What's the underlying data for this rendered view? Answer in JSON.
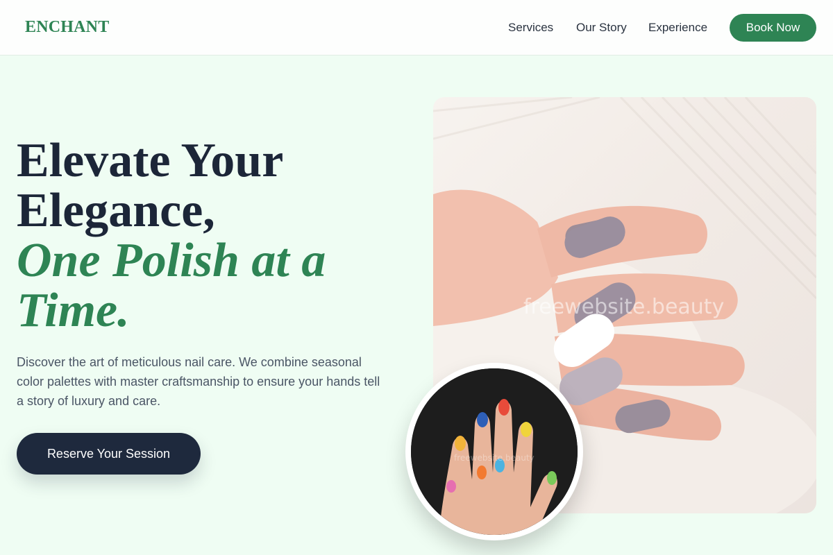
{
  "header": {
    "logo": "ENCHANT",
    "nav": [
      "Services",
      "Our Story",
      "Experience"
    ],
    "cta": "Book Now"
  },
  "hero": {
    "headline_line1": "Elevate Your",
    "headline_line2": "Elegance,",
    "headline_accent_line1": "One Polish at a",
    "headline_accent_line2": "Time.",
    "description": "Discover the art of meticulous nail care. We combine seasonal color palettes with master craftsmanship to ensure your hands tell a story of luxury and care.",
    "cta": "Reserve Your Session",
    "image_watermark": "freewebsite.beauty",
    "circle_watermark": "freewebsite.beauty"
  },
  "colors": {
    "brand_green": "#2e8454",
    "dark_navy": "#1e293d",
    "page_bg": "#effdf3"
  }
}
